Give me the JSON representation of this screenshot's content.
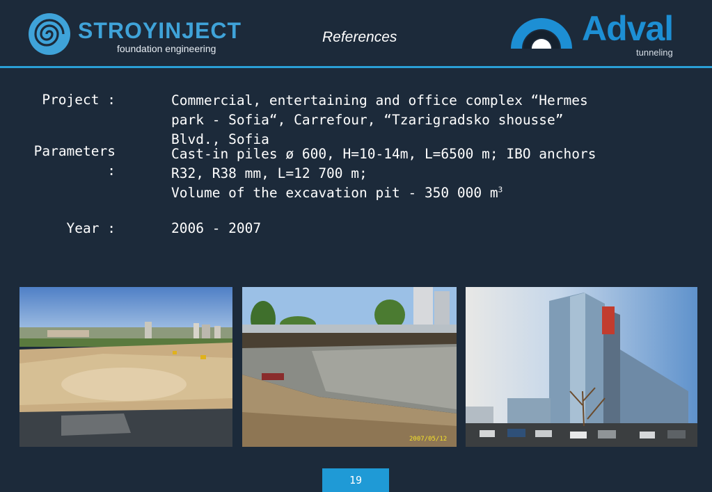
{
  "header": {
    "brand_name": "STROYINJECT",
    "brand_tagline": "foundation engineering",
    "title": "References",
    "partner_name": "Adval",
    "partner_tagline": "tunneling"
  },
  "details": {
    "project_label": "Project :",
    "project_lines": [
      "Commercial, entertaining and office complex “Hermes",
      "park - Sofia“, Carrefour, “Tzarigradsko shousse”",
      "Blvd., Sofia"
    ],
    "parameters_label_1": "Parameters",
    "parameters_label_2": ":",
    "parameters_line_1": "Cast-in piles ø 600, H=10-14m, L=6500 m; IBO anchors",
    "parameters_line_2": "R32, R38 mm, L=12 700 m;",
    "parameters_line_3": "Volume of the excavation pit - 350 000 m",
    "parameters_line_3_sup": "3",
    "year_label": "Year :",
    "year_value": "2006 - 2007"
  },
  "photos": {
    "photo_2_datestamp": "2007/05/12"
  },
  "footer": {
    "page_number": "19"
  },
  "colors": {
    "background": "#1c2a3a",
    "accent": "#2a9fd6",
    "page_badge": "#1f9ad6"
  }
}
